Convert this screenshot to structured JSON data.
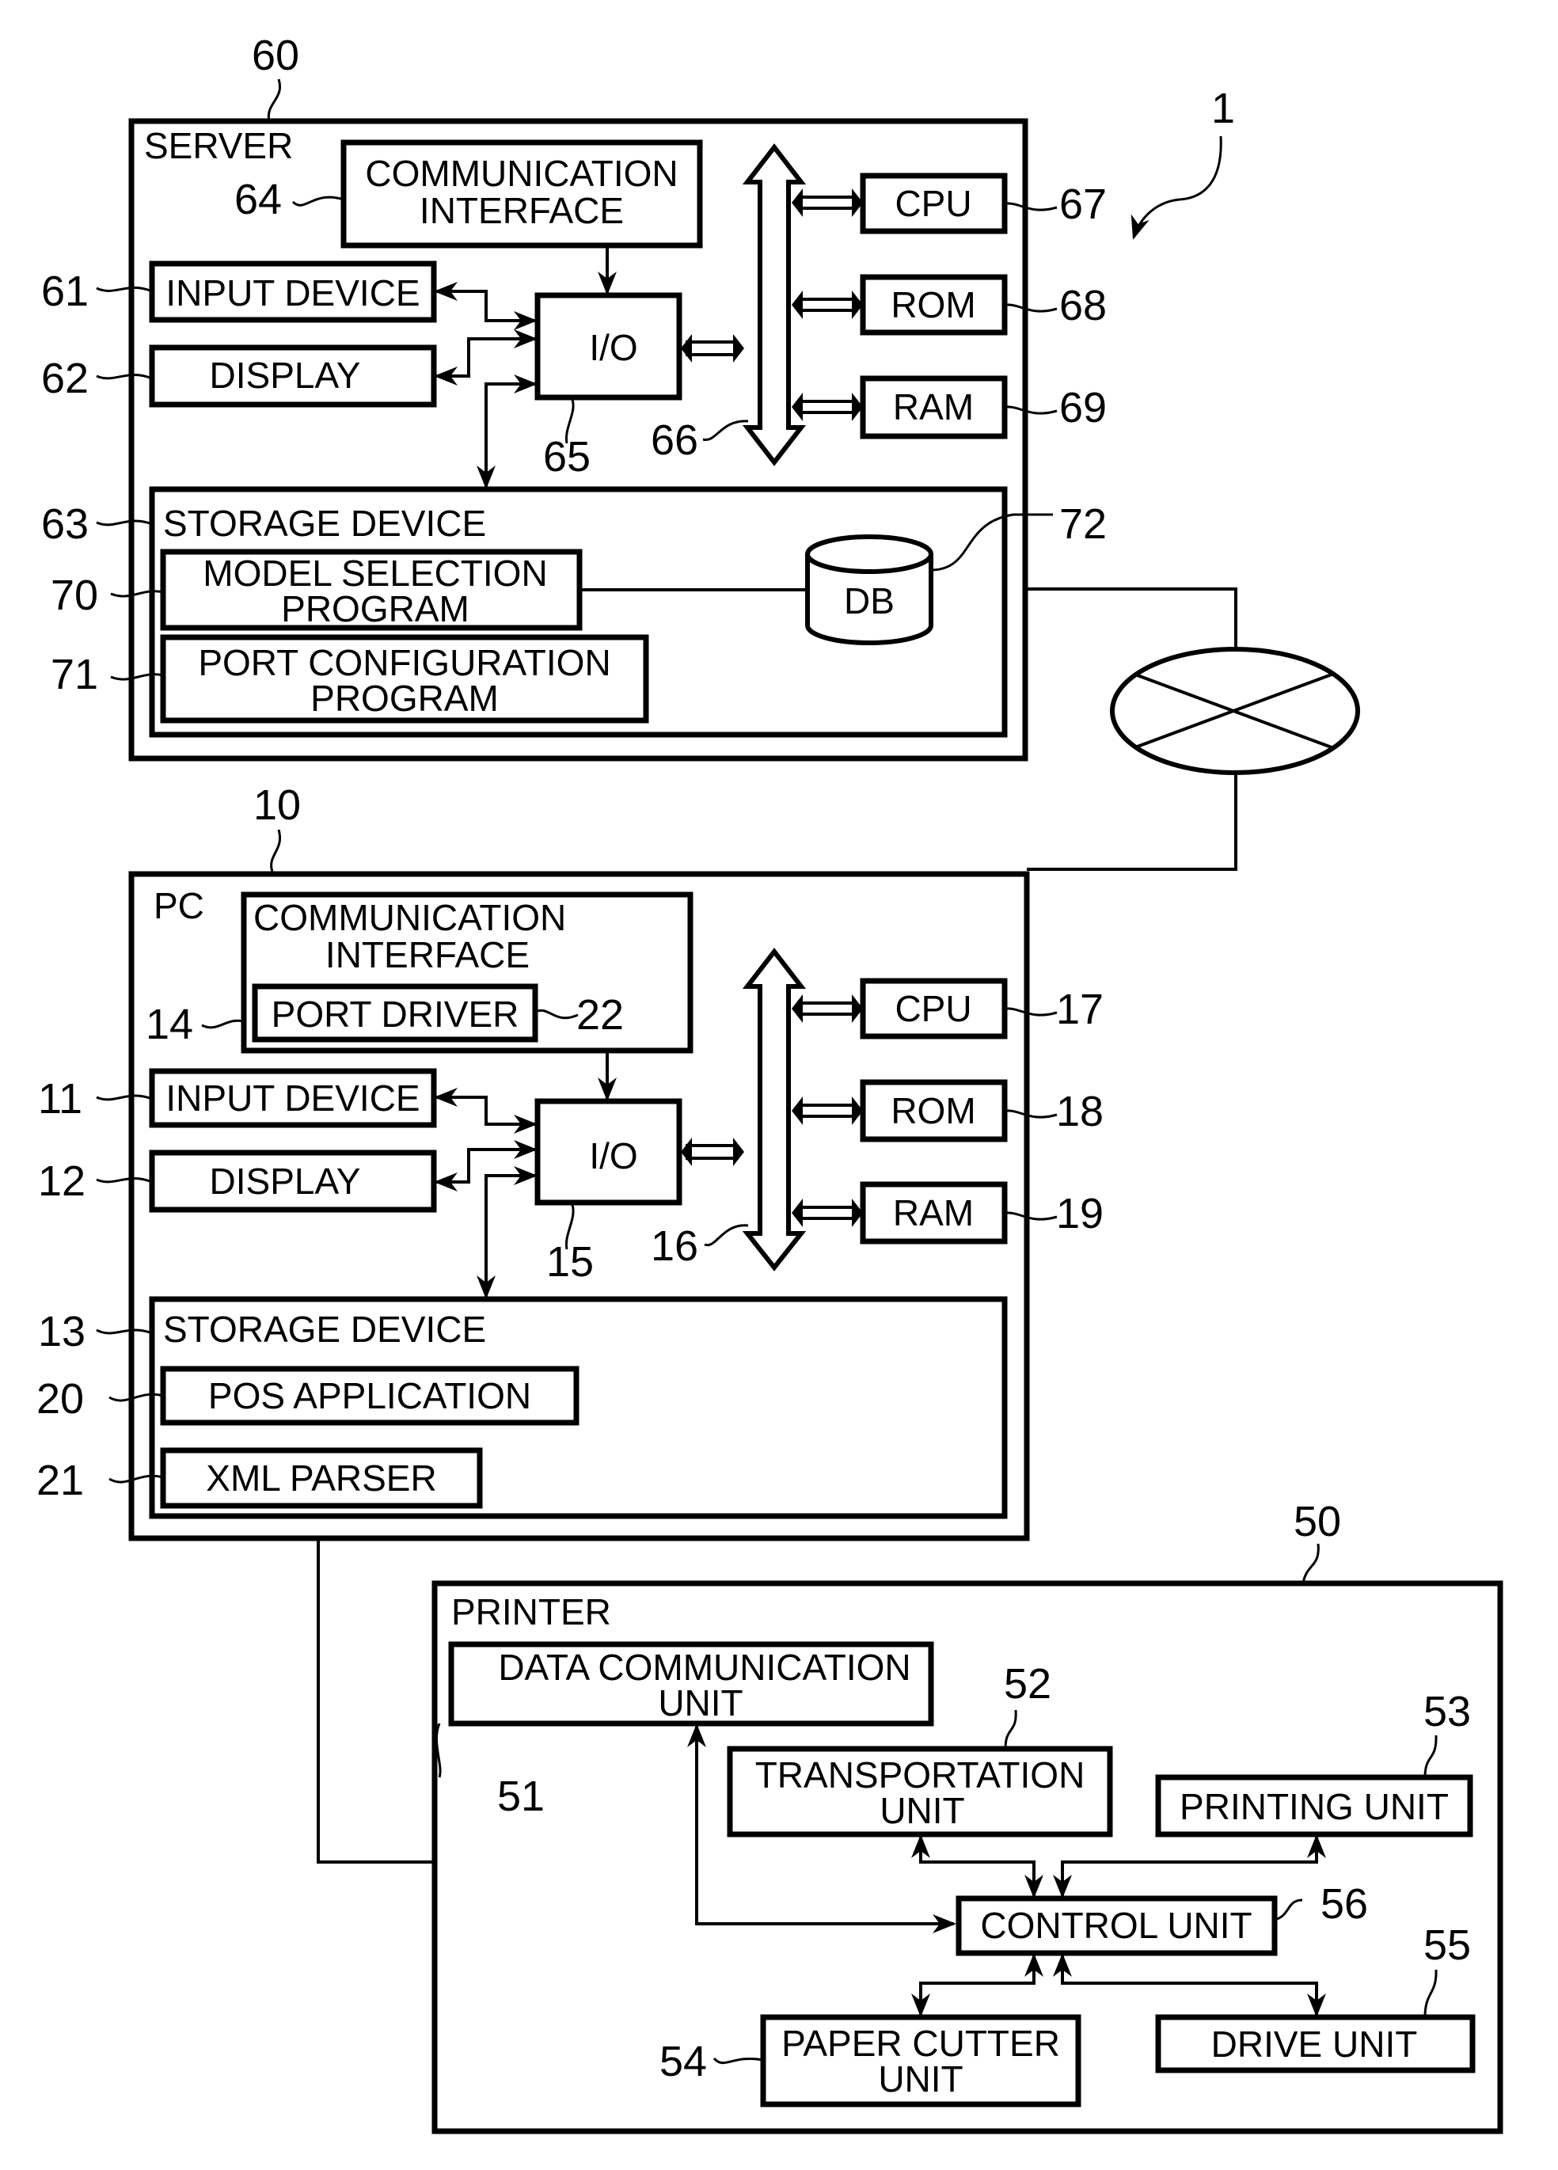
{
  "figure_ref": "1",
  "server": {
    "ref": "60",
    "title": "SERVER",
    "comm_interface": {
      "ref": "64",
      "line1": "COMMUNICATION",
      "line2": "INTERFACE"
    },
    "input_device": {
      "ref": "61",
      "label": "INPUT DEVICE"
    },
    "display": {
      "ref": "62",
      "label": "DISPLAY"
    },
    "io": {
      "ref": "65",
      "label": "I/O"
    },
    "bus": {
      "ref": "66"
    },
    "cpu": {
      "ref": "67",
      "label": "CPU"
    },
    "rom": {
      "ref": "68",
      "label": "ROM"
    },
    "ram": {
      "ref": "69",
      "label": "RAM"
    },
    "storage": {
      "ref": "63",
      "label": "STORAGE DEVICE"
    },
    "model_selection": {
      "ref": "70",
      "line1": "MODEL SELECTION",
      "line2": "PROGRAM"
    },
    "port_config": {
      "ref": "71",
      "line1": "PORT CONFIGURATION",
      "line2": "PROGRAM"
    },
    "db": {
      "ref": "72",
      "label": "DB"
    }
  },
  "pc": {
    "ref": "10",
    "title": "PC",
    "comm_interface": {
      "ref": "14",
      "line1": "COMMUNICATION",
      "line2": "INTERFACE"
    },
    "port_driver": {
      "ref": "22",
      "label": "PORT DRIVER"
    },
    "input_device": {
      "ref": "11",
      "label": "INPUT DEVICE"
    },
    "display": {
      "ref": "12",
      "label": "DISPLAY"
    },
    "io": {
      "ref": "15",
      "label": "I/O"
    },
    "bus": {
      "ref": "16"
    },
    "cpu": {
      "ref": "17",
      "label": "CPU"
    },
    "rom": {
      "ref": "18",
      "label": "ROM"
    },
    "ram": {
      "ref": "19",
      "label": "RAM"
    },
    "storage": {
      "ref": "13",
      "label": "STORAGE DEVICE"
    },
    "pos_app": {
      "ref": "20",
      "label": "POS APPLICATION"
    },
    "xml_parser": {
      "ref": "21",
      "label": "XML PARSER"
    }
  },
  "printer": {
    "ref": "50",
    "title": "PRINTER",
    "data_comm": {
      "ref": "51",
      "line1": "DATA COMMUNICATION",
      "line2": "UNIT"
    },
    "transport": {
      "ref": "52",
      "line1": "TRANSPORTATION",
      "line2": "UNIT"
    },
    "printing": {
      "ref": "53",
      "label": "PRINTING UNIT"
    },
    "paper_cutter": {
      "ref": "54",
      "line1": "PAPER CUTTER",
      "line2": "UNIT"
    },
    "drive": {
      "ref": "55",
      "label": "DRIVE UNIT"
    },
    "control": {
      "ref": "56",
      "label": "CONTROL UNIT"
    }
  }
}
